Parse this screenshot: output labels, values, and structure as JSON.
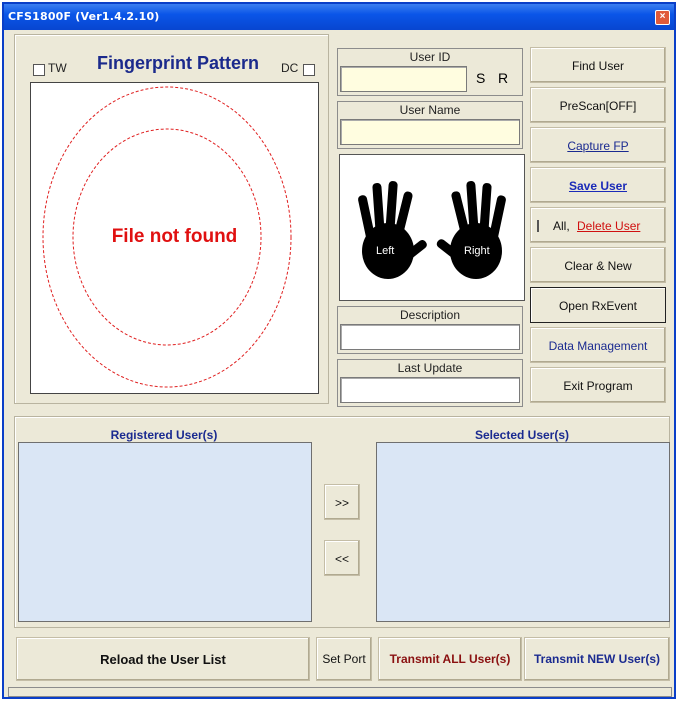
{
  "window": {
    "title": "CFS1800F (Ver1.4.2.10)",
    "close_glyph": "×"
  },
  "fingerprint": {
    "tw_label": "TW",
    "title": "Fingerprint Pattern",
    "dc_label": "DC",
    "message": "File not found"
  },
  "user": {
    "id_label": "User ID",
    "id_value": "",
    "s_label": "S",
    "r_label": "R",
    "name_label": "User Name",
    "name_value": "",
    "description_label": "Description",
    "description_value": "",
    "last_update_label": "Last Update",
    "last_update_value": ""
  },
  "hands": {
    "left_label": "Left",
    "right_label": "Right"
  },
  "buttons": {
    "find_user": "Find User",
    "prescan": "PreScan[OFF]",
    "capture_fp": "Capture FP",
    "save_user": "Save User",
    "all_label": "All,",
    "delete_user": "Delete User",
    "clear_new": "Clear & New",
    "open_rxevent": "Open RxEvent",
    "data_management": "Data Management",
    "exit_program": "Exit Program",
    "move_right": ">>",
    "move_left": "<<",
    "reload_list": "Reload the User List",
    "set_port": "Set Port",
    "transmit_all": "Transmit ALL User(s)",
    "transmit_new": "Transmit NEW User(s)"
  },
  "lists": {
    "registered_title": "Registered User(s)",
    "selected_title": "Selected User(s)"
  },
  "colors": {
    "titlebar": "#0a55e8",
    "window_bg": "#ece9d8",
    "fp_title": "#1b2a8c",
    "error_text": "#e01010",
    "list_bg": "#dae6f5",
    "input_bg": "#fffde0"
  }
}
